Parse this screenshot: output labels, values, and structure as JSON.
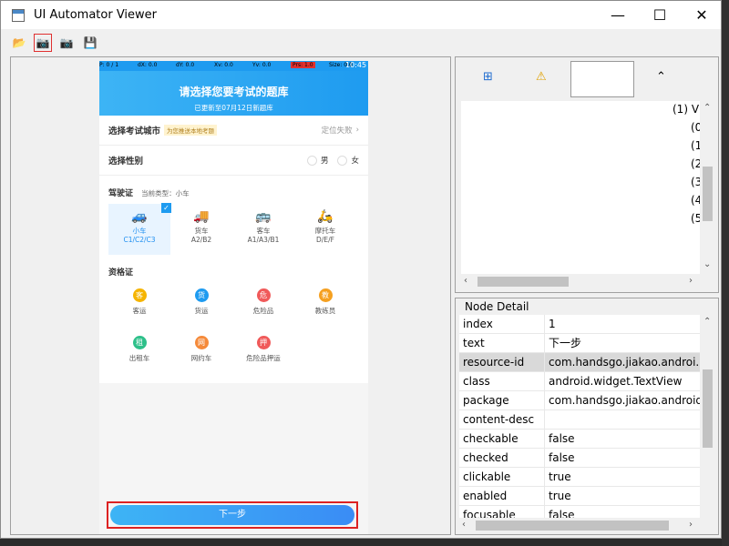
{
  "window": {
    "title": "UI Automator Viewer",
    "minimize": "—",
    "maximize": "☐",
    "close": "✕"
  },
  "toolbar": {
    "open": "📂",
    "screenshot": "📷",
    "screenshot_compressed": "📷",
    "save": "💾"
  },
  "phone": {
    "status": {
      "p": "P: 0 / 1",
      "dx": "dX: 0.0",
      "dy": "dY: 0.0",
      "xv": "Xv: 0.0",
      "yv": "Yv: 0.0",
      "prs": "Prs: 1.0",
      "size": "Size: 0.0",
      "time": "10:45"
    },
    "header": {
      "title": "请选择您要考试的题库",
      "subtitle": "已更新至07月12日新题库"
    },
    "city": {
      "label": "选择考试城市",
      "tag": "为您推送本地考题",
      "value": "定位失败"
    },
    "gender": {
      "label": "选择性别",
      "male": "男",
      "female": "女"
    },
    "license": {
      "label": "驾驶证",
      "current_label": "当前类型：小车"
    },
    "vehicles": [
      {
        "name": "小车",
        "code": "C1/C2/C3",
        "icon": "🚙",
        "selected": true
      },
      {
        "name": "货车",
        "code": "A2/B2",
        "icon": "🚚",
        "selected": false
      },
      {
        "name": "客车",
        "code": "A1/A3/B1",
        "icon": "🚌",
        "selected": false
      },
      {
        "name": "摩托车",
        "code": "D/E/F",
        "icon": "🛵",
        "selected": false
      }
    ],
    "qualification": {
      "label": "资格证"
    },
    "qualifications": [
      {
        "name": "客运",
        "glyph": "客",
        "color": "#f5b400"
      },
      {
        "name": "货运",
        "glyph": "货",
        "color": "#1e9bf0"
      },
      {
        "name": "危险品",
        "glyph": "危",
        "color": "#f05a5a"
      },
      {
        "name": "教练员",
        "glyph": "教",
        "color": "#f5a020"
      },
      {
        "name": "出租车",
        "glyph": "租",
        "color": "#2ec08a"
      },
      {
        "name": "网约车",
        "glyph": "网",
        "color": "#f58a3a"
      },
      {
        "name": "危险品押运",
        "glyph": "押",
        "color": "#f05a5a"
      }
    ],
    "next_button": "下一步"
  },
  "hierarchy": {
    "lines": [
      "(1) V",
      "(0",
      "(1",
      "(2",
      "(3",
      "(4",
      "(5"
    ]
  },
  "node_detail": {
    "title": "Node Detail",
    "rows": [
      {
        "key": "index",
        "value": "1"
      },
      {
        "key": "text",
        "value": "下一步"
      },
      {
        "key": "resource-id",
        "value": "com.handsgo.jiakao.androi..."
      },
      {
        "key": "class",
        "value": "android.widget.TextView"
      },
      {
        "key": "package",
        "value": "com.handsgo.jiakao.android"
      },
      {
        "key": "content-desc",
        "value": ""
      },
      {
        "key": "checkable",
        "value": "false"
      },
      {
        "key": "checked",
        "value": "false"
      },
      {
        "key": "clickable",
        "value": "true"
      },
      {
        "key": "enabled",
        "value": "true"
      },
      {
        "key": "focusable",
        "value": "false"
      }
    ]
  }
}
